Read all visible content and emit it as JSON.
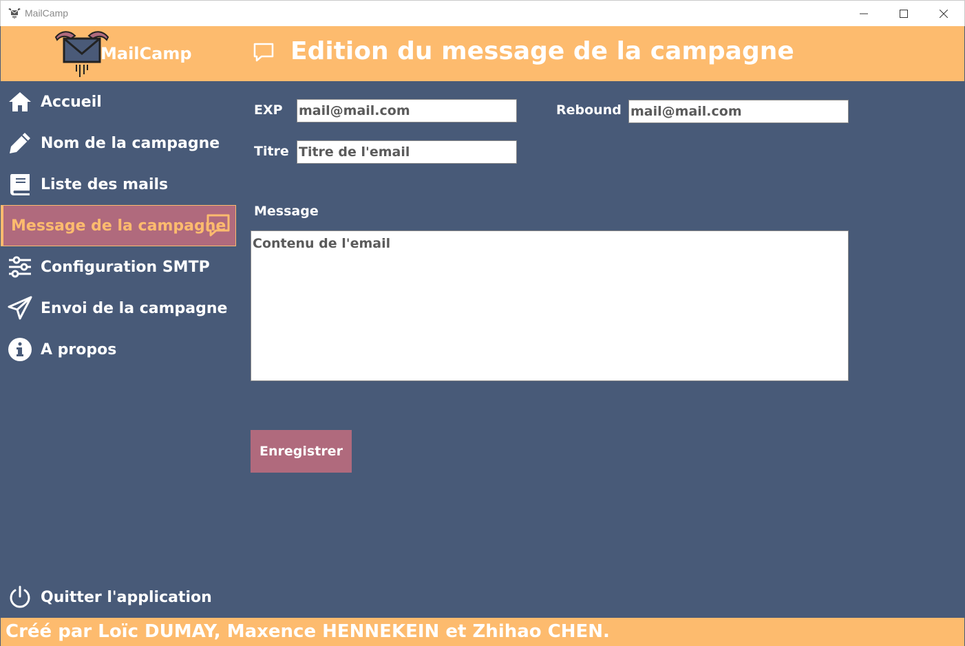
{
  "window": {
    "title": "MailCamp",
    "icon": "mailcamp-app-icon"
  },
  "header": {
    "brand": "MailCamp",
    "title": "Edition du message de la campagne",
    "title_icon": "chat-bubble-icon",
    "background_color": "#fdbb6e"
  },
  "sidebar": {
    "items": [
      {
        "label": "Accueil",
        "icon": "home-icon",
        "active": false
      },
      {
        "label": "Nom de la campagne",
        "icon": "pencil-icon",
        "active": false
      },
      {
        "label": "Liste des mails",
        "icon": "book-icon",
        "active": false
      },
      {
        "label": "Message de la campagne",
        "icon": "chat-bubble-icon",
        "active": true
      },
      {
        "label": "Configuration SMTP",
        "icon": "sliders-icon",
        "active": false
      },
      {
        "label": "Envoi de la campagne",
        "icon": "paper-plane-icon",
        "active": false
      },
      {
        "label": "A propos",
        "icon": "info-icon",
        "active": false
      }
    ],
    "quit": {
      "label": "Quitter l'application",
      "icon": "power-icon"
    },
    "active_color": "#b06a7d"
  },
  "form": {
    "exp": {
      "label": "EXP",
      "value": "mail@mail.com"
    },
    "rebound": {
      "label": "Rebound",
      "value": "mail@mail.com"
    },
    "titre": {
      "label": "Titre",
      "value": "Titre de l'email"
    },
    "message": {
      "label": "Message",
      "value": "Contenu de l'email"
    },
    "save_label": "Enregistrer"
  },
  "footer": {
    "credits": "Créé par Loïc DUMAY, Maxence HENNEKEIN et Zhihao CHEN."
  },
  "colors": {
    "accent": "#fdbb6e",
    "background": "#485a78",
    "button": "#b06a7d"
  }
}
